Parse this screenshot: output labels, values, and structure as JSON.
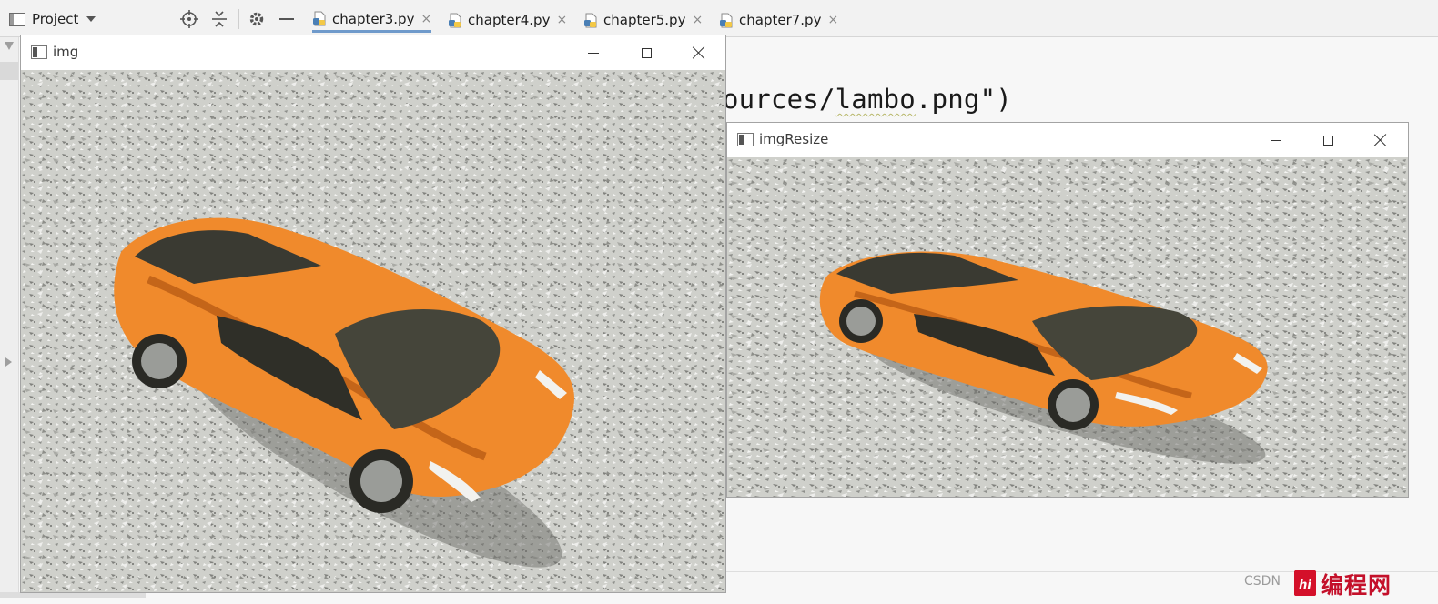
{
  "toolbar": {
    "project_label": "Project",
    "tabs": [
      {
        "label": "chapter3.py",
        "active": true
      },
      {
        "label": "chapter4.py",
        "active": false
      },
      {
        "label": "chapter5.py",
        "active": false
      },
      {
        "label": "chapter7.py",
        "active": false
      }
    ],
    "close_glyph": "×"
  },
  "editor": {
    "code_visible_prefix": "ources/",
    "code_visible_underlined": "lambo",
    "code_visible_suffix": ".png\")"
  },
  "windows": {
    "img": {
      "title": "img"
    },
    "img_resize": {
      "title": "imgResize"
    }
  },
  "watermark": {
    "csdn": "CSDN",
    "site_name": "编程网",
    "logo_letter": "hi"
  },
  "colors": {
    "accent_tab_underline": "#6f9acb",
    "car_orange": "#f08a2c",
    "watermark_red": "#c4102a"
  }
}
